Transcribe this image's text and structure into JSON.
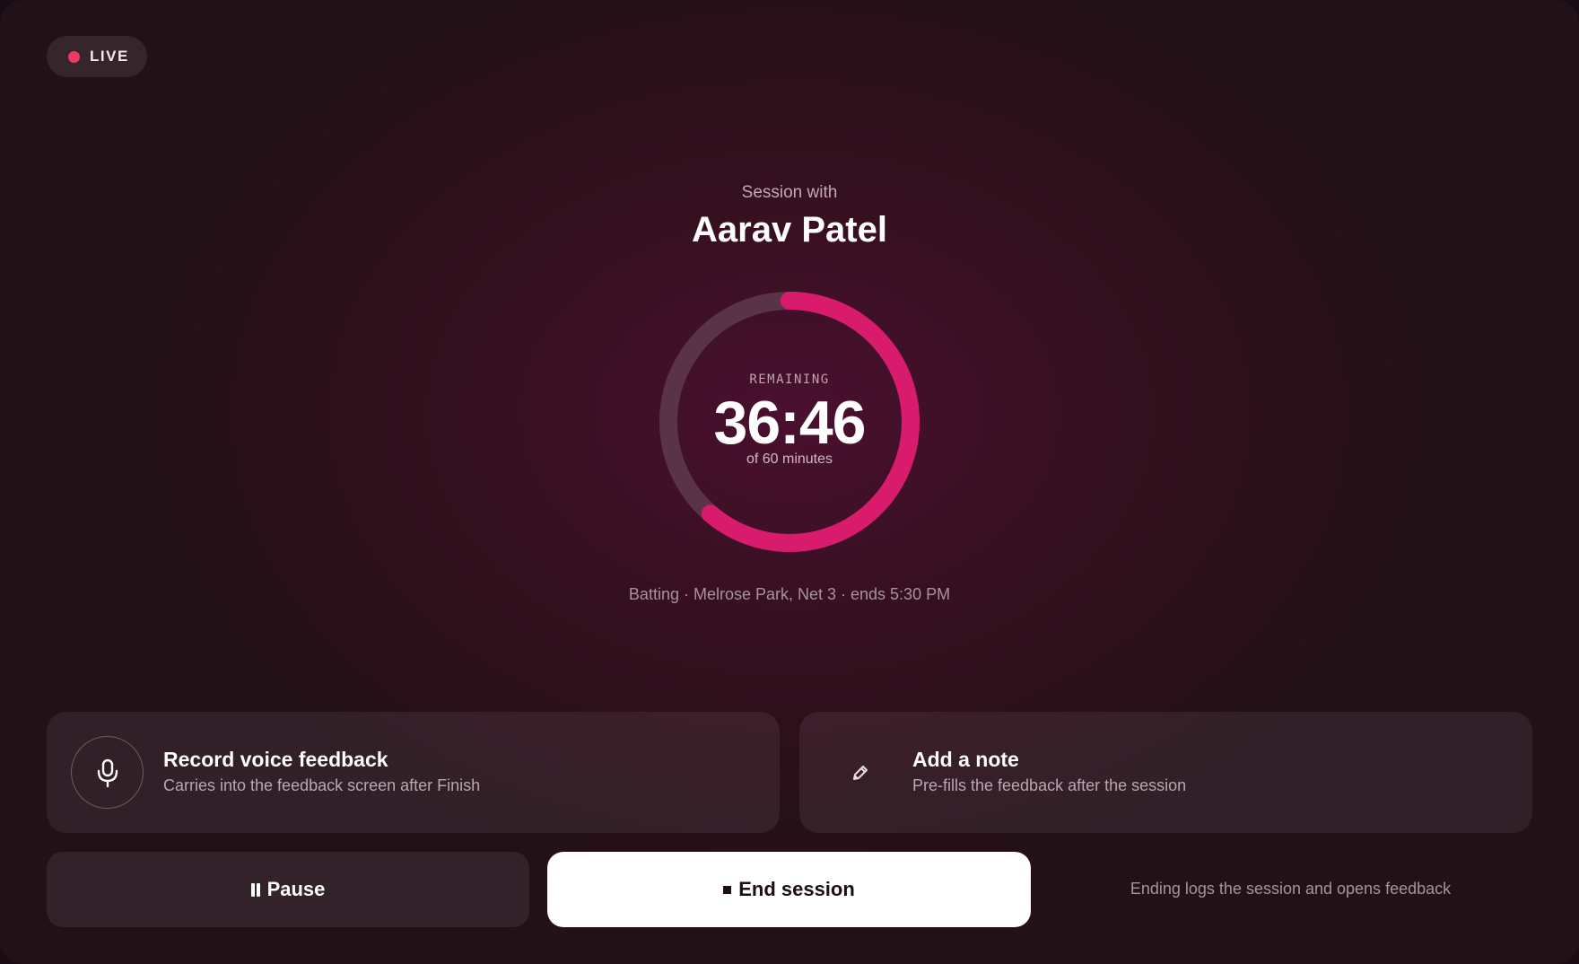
{
  "status": {
    "live_label": "LIVE"
  },
  "session": {
    "heading": "Session with",
    "athlete_name": "Aarav Patel",
    "details": "Batting · Melrose Park, Net 3 · ends 5:30 PM"
  },
  "timer": {
    "label": "REMAINING",
    "value": "36:46",
    "total_label": "of 60 minutes",
    "remaining_fraction": 0.613,
    "ring_color": "#d81b6d",
    "track_color": "#5a3347"
  },
  "actions": {
    "voice": {
      "icon": "microphone-icon",
      "title": "Record voice feedback",
      "subtitle": "Carries into the feedback screen after Finish"
    },
    "note": {
      "icon": "pencil-icon",
      "title": "Add a note",
      "subtitle": "Pre-fills the feedback after the session"
    }
  },
  "controls": {
    "pause_label": "Pause",
    "pause_icon": "pause-icon",
    "end_label": "End session",
    "end_icon": "stop-icon",
    "end_hint": "Ending logs the session and opens feedback"
  },
  "colors": {
    "accent": "#d81b6d",
    "live_dot": "#ec3a63",
    "background": "#2a1019"
  }
}
